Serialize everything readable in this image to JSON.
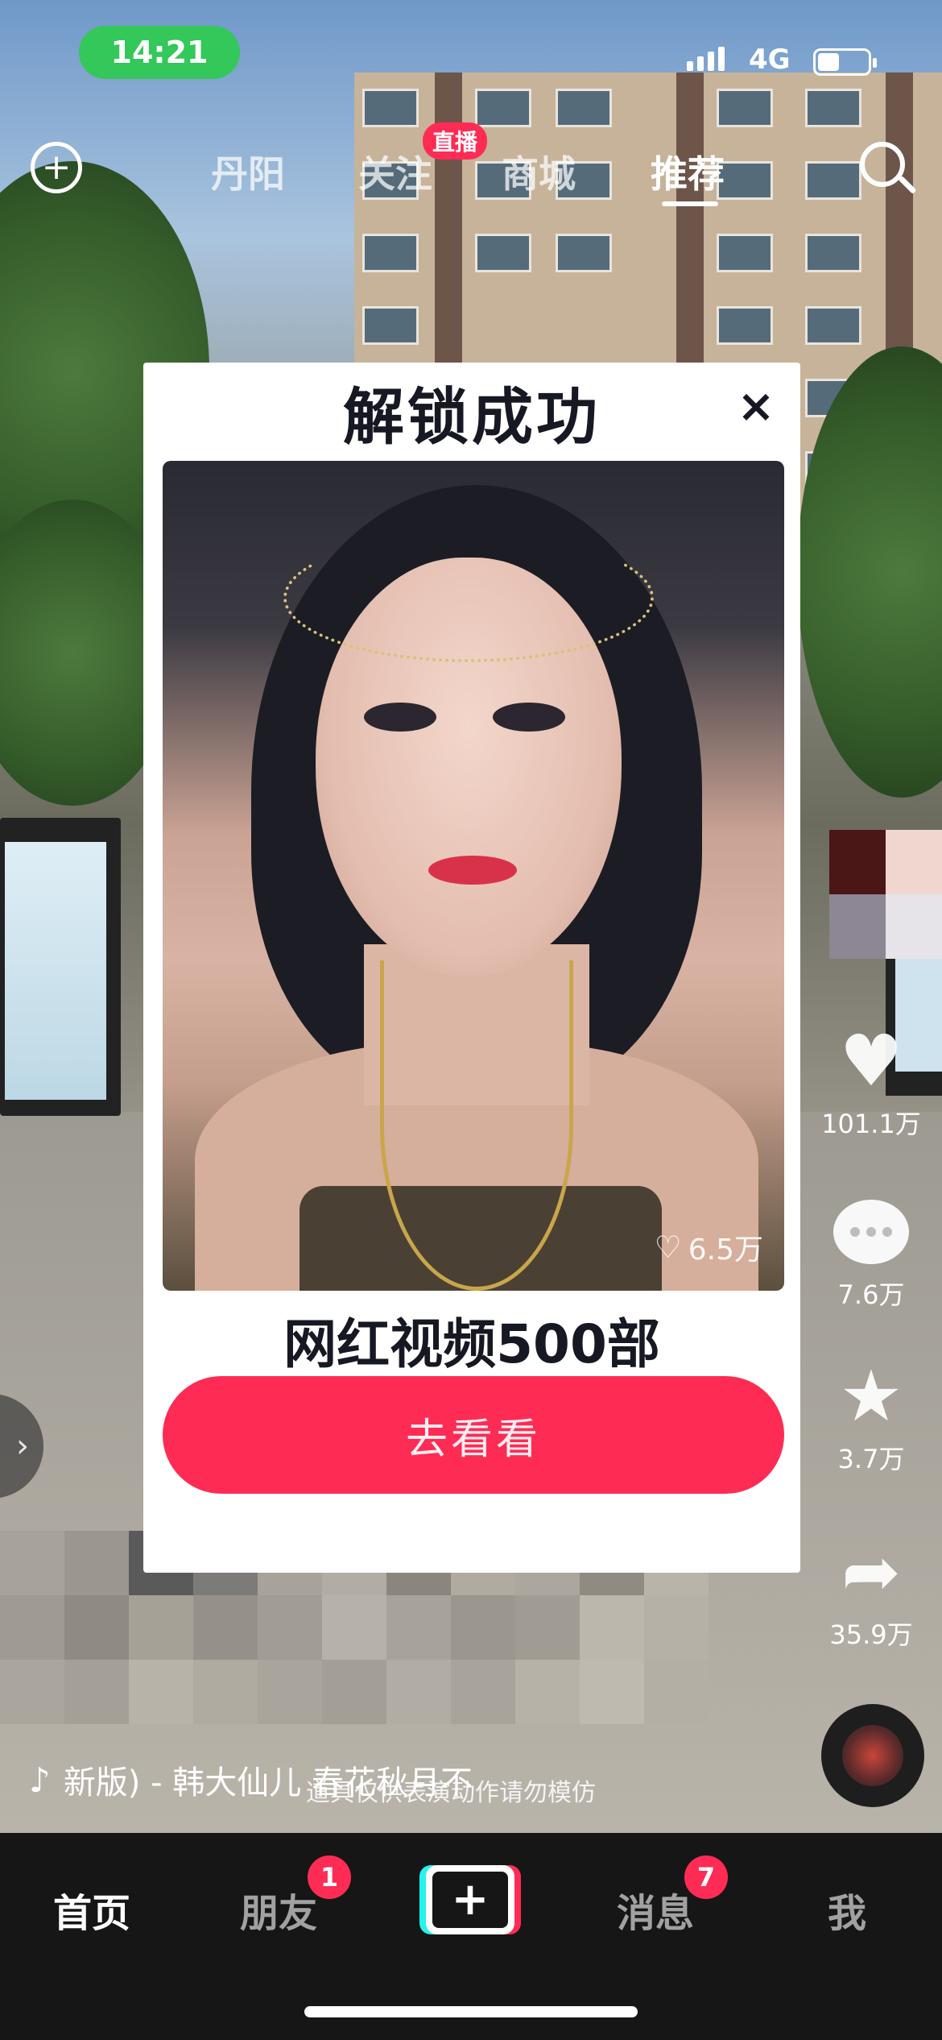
{
  "status_bar": {
    "time": "14:21",
    "network": "4G"
  },
  "top_nav": {
    "tabs": [
      {
        "label": "丹阳",
        "active": false
      },
      {
        "label": "关注",
        "active": false
      },
      {
        "label": "商城",
        "active": false
      },
      {
        "label": "推荐",
        "active": true
      }
    ],
    "live_badge": "直播"
  },
  "modal": {
    "title": "解锁成功",
    "close_symbol": "×",
    "photo_likes": "6.5万",
    "subtitle": "网红视频500部",
    "button_label": "去看看"
  },
  "side_rail": {
    "likes": "101.1万",
    "comments": "7.6万",
    "favorites": "3.7万",
    "shares": "35.9万"
  },
  "caption": {
    "music_text": "新版) - 韩大仙儿   春花秋月不",
    "overlay_text": "道具仅供表演动作请勿模仿"
  },
  "tab_bar": {
    "home": "首页",
    "friends": "朋友",
    "friends_badge": "1",
    "create": "+",
    "messages": "消息",
    "messages_badge": "7",
    "me": "我"
  },
  "colors": {
    "accent": "#fe2c55",
    "time_pill": "#34c759",
    "cyan": "#25f4ee"
  }
}
